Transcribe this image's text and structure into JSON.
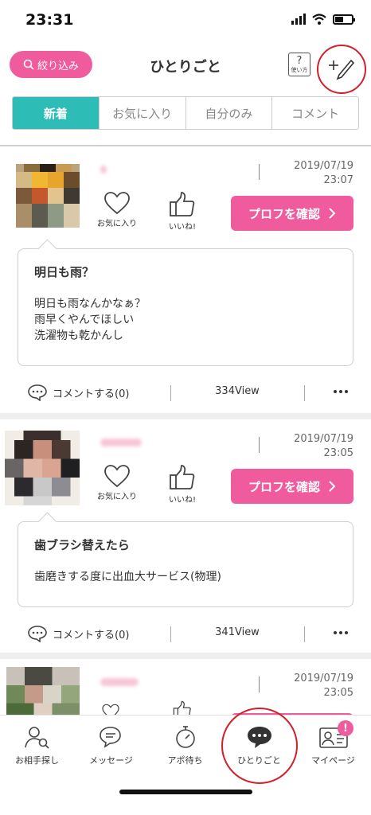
{
  "status": {
    "time": "23:31"
  },
  "header": {
    "filter_label": "絞り込み",
    "title": "ひとりごと",
    "help_icon_text": "?",
    "help_label": "使い方"
  },
  "tabs": [
    {
      "label": "新着",
      "active": true
    },
    {
      "label": "お気に入り",
      "active": false
    },
    {
      "label": "自分のみ",
      "active": false
    },
    {
      "label": "コメント",
      "active": false
    }
  ],
  "actions": {
    "favorite_label": "お気に入り",
    "like_label": "いいね!",
    "profile_button": "プロフを確認"
  },
  "posts": [
    {
      "date": "2019/07/19",
      "time": "23:07",
      "title": "明日も雨？",
      "body": [
        "明日も雨なんかなぁ？",
        "雨早くやんでほしい",
        "洗濯物も乾かんし"
      ],
      "comment_label": "コメントする(0)",
      "views": "334View"
    },
    {
      "date": "2019/07/19",
      "time": "23:05",
      "title": "歯ブラシ替えたら",
      "body": [
        "歯磨きする度に出血大サービス(物理)"
      ],
      "comment_label": "コメントする(0)",
      "views": "341View"
    },
    {
      "date": "2019/07/19",
      "time": "23:05"
    }
  ],
  "nav": [
    {
      "label": "お相手探し",
      "icon": "person-search-icon"
    },
    {
      "label": "メッセージ",
      "icon": "chat-bubbles-icon"
    },
    {
      "label": "アポ待ち",
      "icon": "stopwatch-icon"
    },
    {
      "label": "ひとりごと",
      "icon": "speech-bubble-icon",
      "active": true
    },
    {
      "label": "マイページ",
      "icon": "profile-card-icon",
      "badge": "!"
    }
  ],
  "colors": {
    "accent_pink": "#ef5b9c",
    "tab_teal": "#2dbdb6",
    "annotation_red": "#d21f2b"
  }
}
